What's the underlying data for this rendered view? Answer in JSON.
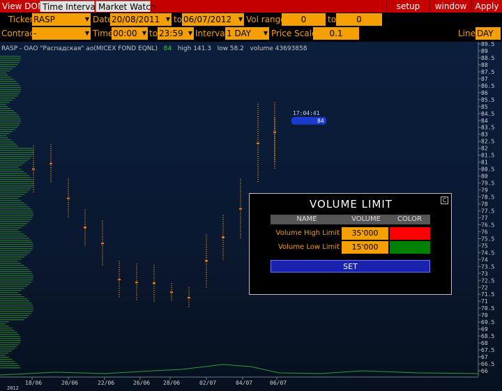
{
  "tabs": [
    {
      "label": "View DOM",
      "active": false
    },
    {
      "label": "Time Interval",
      "active": true
    },
    {
      "label": "Market Watch",
      "active": false
    }
  ],
  "top_buttons": [
    "setup",
    "window",
    "Apply"
  ],
  "params": {
    "ticker_label": "Ticker",
    "ticker_value": "RASP",
    "date_label": "Date",
    "date_from": "20/08/2011",
    "to_label": "to",
    "date_to": "06/07/2012",
    "volrange_label": "Vol range",
    "vol_from": "0",
    "vol_to_label": "to",
    "vol_to": "0",
    "contract_label": "Contract",
    "contract_value": "-",
    "time_label": "Time",
    "time_from": "00:00",
    "time_to_label": "to",
    "time_to": "23:59",
    "interval_label": "Interval",
    "interval_value": "1 DAY",
    "pricescale_label": "Price Scale",
    "pricescale_value": "0.1",
    "line_label": "Line",
    "line_value": "DAY"
  },
  "chart_info": {
    "name": "RASP - ОАО \"Распадская\" ао(MICEX FOND EQNL)",
    "last": "84",
    "high": "high 141.3",
    "low": "low 58.2",
    "volume": "volume 43693858"
  },
  "price_tag": {
    "time": "17:04:41",
    "price": "84"
  },
  "chart_data": {
    "type": "scatter",
    "x_ticks": [
      "18/06",
      "20/06",
      "22/06",
      "26/06",
      "28/06",
      "02/07",
      "04/07",
      "06/07"
    ],
    "year_label": "2012",
    "y_ticks": [
      "89.5",
      "89",
      "88.5",
      "88",
      "87.5",
      "87",
      "86.5",
      "86",
      "85.5",
      "85",
      "84.5",
      "84",
      "83.5",
      "83",
      "82.5",
      "82",
      "81.5",
      "81",
      "80.5",
      "80",
      "79.5",
      "79",
      "78.5",
      "78",
      "77.5",
      "77",
      "76.5",
      "76",
      "75.5",
      "75",
      "74.5",
      "74",
      "73.5",
      "73",
      "72.5",
      "72",
      "71.5",
      "71",
      "70.5",
      "70",
      "69.5",
      "69",
      "68.5",
      "68",
      "67.5",
      "67",
      "66.5",
      "66"
    ],
    "ylim": [
      66,
      89.5
    ],
    "bars": [
      {
        "x": "15/06",
        "low": 78.8,
        "high": 82.2
      },
      {
        "x": "18/06",
        "low": 79.5,
        "high": 82.3
      },
      {
        "x": "19/06",
        "low": 77.0,
        "high": 79.8
      },
      {
        "x": "20/06",
        "low": 75.0,
        "high": 77.6
      },
      {
        "x": "21/06",
        "low": 73.5,
        "high": 76.8
      },
      {
        "x": "22/06",
        "low": 71.2,
        "high": 73.9
      },
      {
        "x": "25/06",
        "low": 71.0,
        "high": 73.7
      },
      {
        "x": "26/06",
        "low": 71.0,
        "high": 73.6
      },
      {
        "x": "27/06",
        "low": 71.0,
        "high": 72.3
      },
      {
        "x": "28/06",
        "low": 70.5,
        "high": 72.0
      },
      {
        "x": "29/06",
        "low": 72.0,
        "high": 75.8
      },
      {
        "x": "02/07",
        "low": 74.0,
        "high": 77.2
      },
      {
        "x": "03/07",
        "low": 75.5,
        "high": 79.8
      },
      {
        "x": "04/07",
        "low": 79.5,
        "high": 85.2
      },
      {
        "x": "05/07",
        "low": 81.0,
        "high": 85.3
      },
      {
        "x": "06/07",
        "low": 80.5,
        "high": 84.2
      }
    ]
  },
  "dialog": {
    "title": "VOLUME LIMIT",
    "close": "C",
    "headers": [
      "NAME",
      "VOLUME",
      "COLOR"
    ],
    "rows": [
      {
        "name": "Volume High Limit",
        "volume": "35'000",
        "color": "#ff0000"
      },
      {
        "name": "Volume Low Limit",
        "volume": "15'000",
        "color": "#008000"
      }
    ],
    "set_label": "SET"
  },
  "colors": {
    "accent": "#f5a000",
    "header_bar": "#c40000",
    "background": "#0b1e3c"
  }
}
